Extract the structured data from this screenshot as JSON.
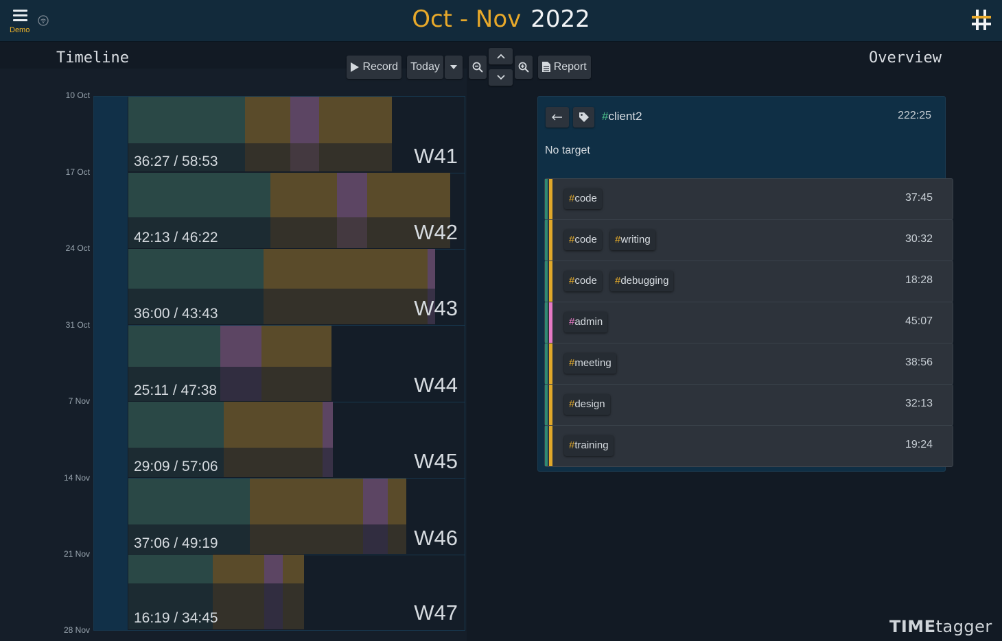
{
  "header": {
    "menu_label": "Demo",
    "title_months": "Oct - Nov",
    "title_year": "2022"
  },
  "timeline": {
    "title": "Timeline",
    "date_labels": [
      "10 Oct",
      "17 Oct",
      "24 Oct",
      "31 Oct",
      "7 Nov",
      "14 Nov",
      "21 Nov",
      "28 Nov"
    ],
    "weeks": [
      {
        "label": "W41",
        "hours": "36:27 / 58:53"
      },
      {
        "label": "W42",
        "hours": "42:13 / 46:22"
      },
      {
        "label": "W43",
        "hours": "36:00 / 43:43"
      },
      {
        "label": "W44",
        "hours": "25:11 / 47:38"
      },
      {
        "label": "W45",
        "hours": "29:09 / 57:06"
      },
      {
        "label": "W46",
        "hours": "37:06 / 49:19"
      },
      {
        "label": "W47",
        "hours": "16:19 / 34:45"
      }
    ]
  },
  "toolbar": {
    "record_label": "Record",
    "today_label": "Today",
    "report_label": "Report"
  },
  "overview": {
    "title": "Overview",
    "tag_name": "client2",
    "total": "222:25",
    "target_text": "No target",
    "rows": [
      {
        "tags": [
          "code"
        ],
        "duration": "37:45"
      },
      {
        "tags": [
          "code",
          "writing"
        ],
        "duration": "30:32"
      },
      {
        "tags": [
          "code",
          "debugging"
        ],
        "duration": "18:28"
      },
      {
        "tags": [
          "admin"
        ],
        "duration": "45:07"
      },
      {
        "tags": [
          "meeting"
        ],
        "duration": "38:56"
      },
      {
        "tags": [
          "design"
        ],
        "duration": "32:13"
      },
      {
        "tags": [
          "training"
        ],
        "duration": "19:24"
      }
    ]
  },
  "brand": {
    "part1": "TIME",
    "part2": "tagger"
  },
  "colors": {
    "accent": "#e8a92a",
    "tag_green": "#4cbf8a",
    "tag_pink": "#e679c4",
    "bar_bg": "#122a3b"
  }
}
